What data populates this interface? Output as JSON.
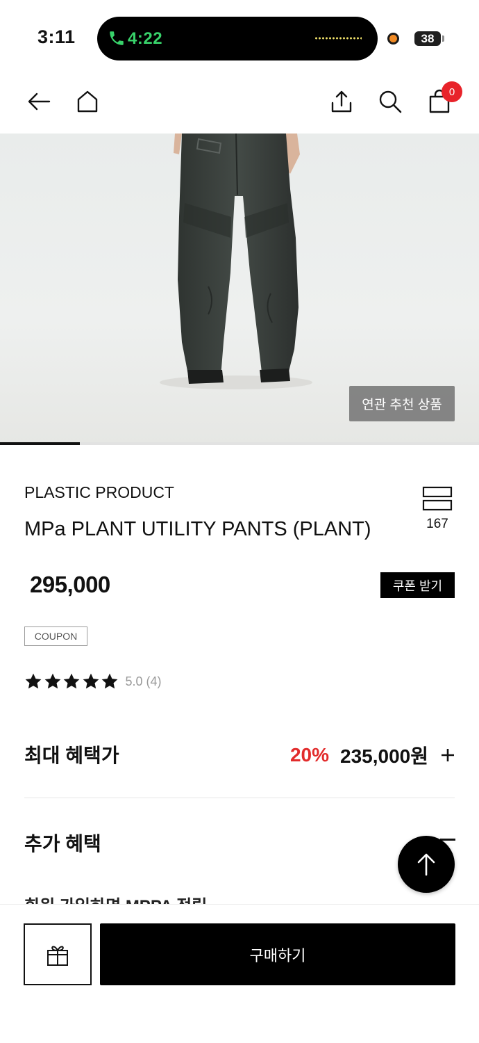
{
  "status_bar": {
    "time": "3:11",
    "call_time": "4:22",
    "battery_level": "38",
    "colors": {
      "call": "#38d26a",
      "record_dot": "#f08a24"
    }
  },
  "nav": {
    "back_icon": "arrow-left-icon",
    "home_icon": "home-icon",
    "share_icon": "share-icon",
    "search_icon": "search-icon",
    "cart_icon": "shopping-bag-icon",
    "cart_count": "0",
    "badge_color": "#e8232a"
  },
  "hero": {
    "related_label": "연관 추천 상품",
    "slide_progress": 0.167
  },
  "product": {
    "brand": "PLASTIC PRODUCT",
    "name": "MPa PLANT UTILITY PANTS (PLANT)",
    "like_count": "167",
    "price": "295,000",
    "coupon_button": "쿠폰 받기",
    "coupon_tag": "COUPON",
    "rating": {
      "stars": 5,
      "text": "5.0 (4)"
    }
  },
  "benefits": {
    "max_label": "최대 혜택가",
    "discount": "20%",
    "sale_price": "235,000원",
    "discount_color": "#e22b2b",
    "extra_label": "추가 혜택",
    "cutoff_text": "회원 가입하면 MPPA 적립"
  },
  "bottom_bar": {
    "gift_icon": "gift-icon",
    "buy_label": "구매하기"
  }
}
